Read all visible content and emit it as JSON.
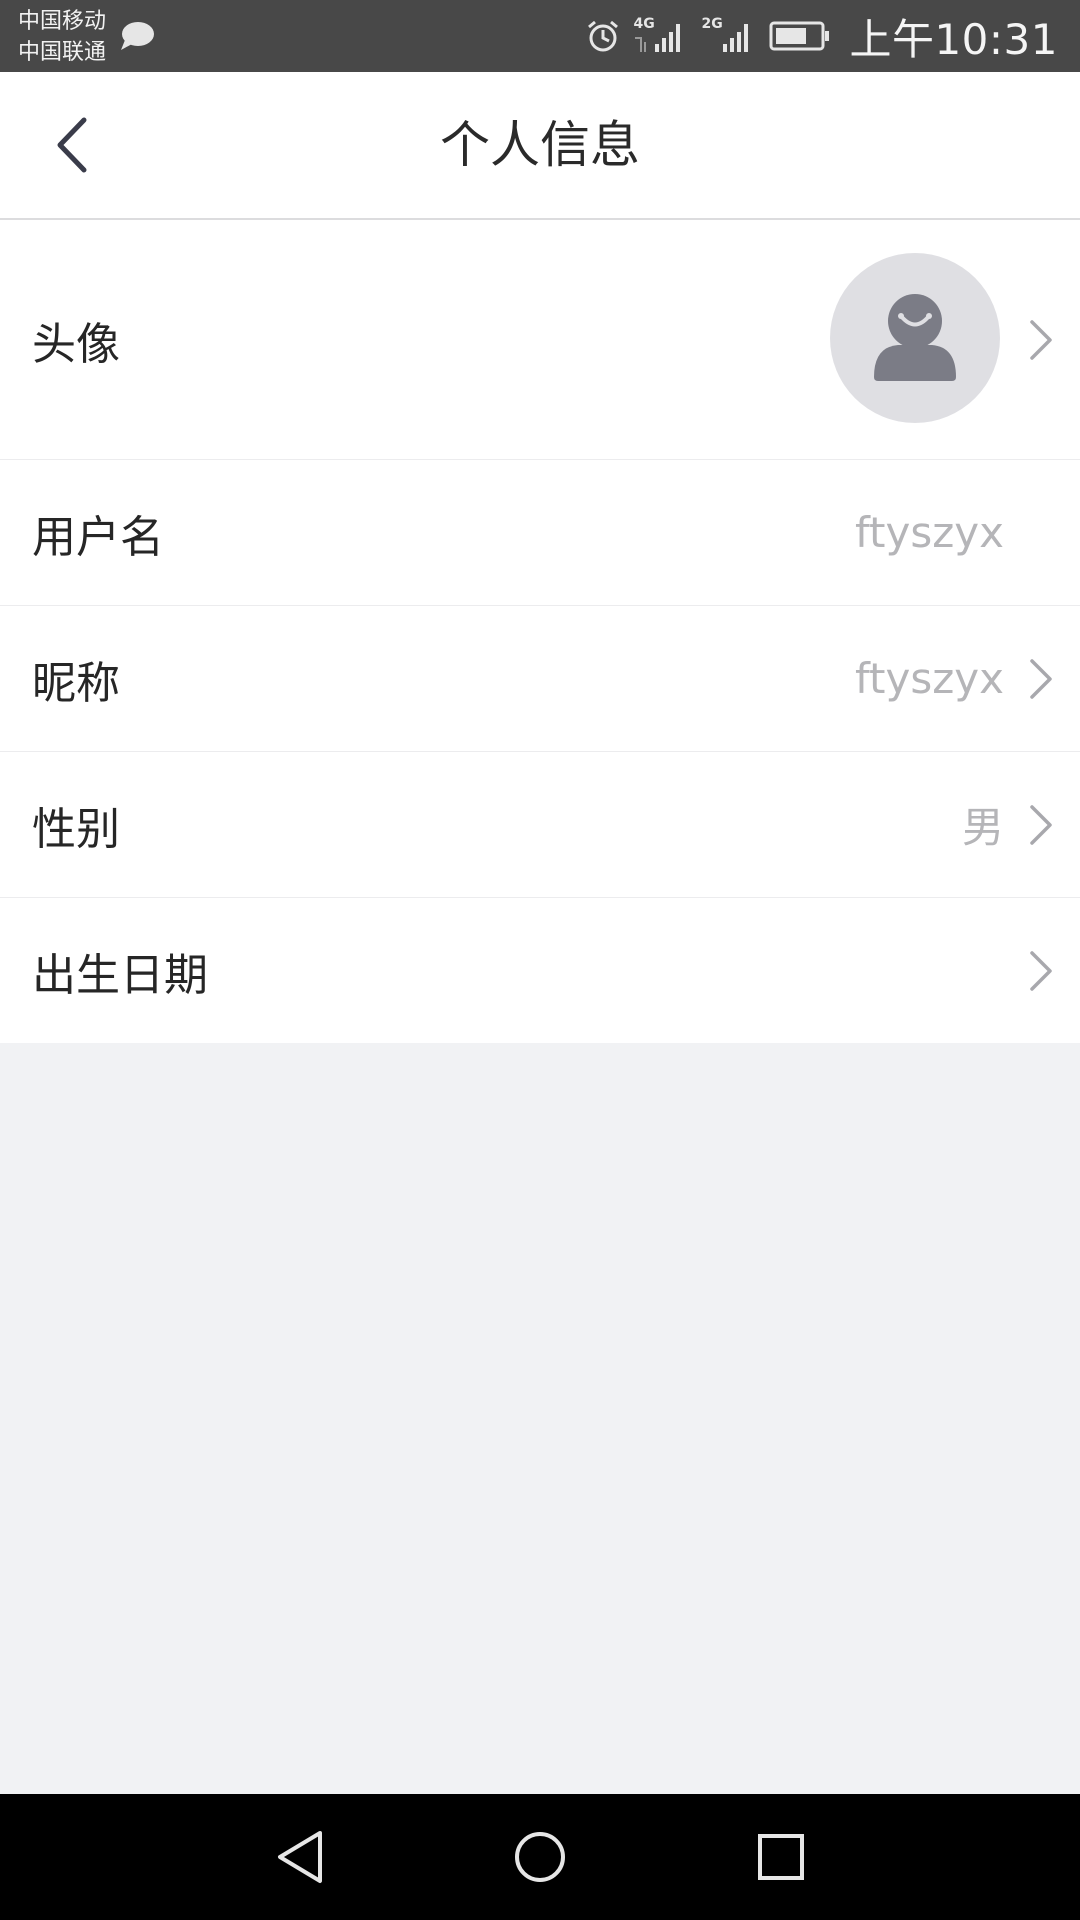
{
  "status_bar": {
    "carrier_1": "中国移动",
    "carrier_2": "中国联通",
    "network_1": "4G",
    "network_2": "2G",
    "time": "上午10:31"
  },
  "header": {
    "title": "个人信息"
  },
  "rows": [
    {
      "label": "头像",
      "value": "",
      "icon": "avatar-placeholder",
      "has_chevron": true
    },
    {
      "label": "用户名",
      "value": "ftyszyx",
      "has_chevron": false
    },
    {
      "label": "昵称",
      "value": "ftyszyx",
      "has_chevron": true
    },
    {
      "label": "性别",
      "value": "男",
      "has_chevron": true
    },
    {
      "label": "出生日期",
      "value": "",
      "has_chevron": true
    }
  ],
  "colors": {
    "status_bar": "#484848",
    "background": "#f1f2f4",
    "value_text": "#b5b5b8",
    "label_text": "#262626"
  }
}
